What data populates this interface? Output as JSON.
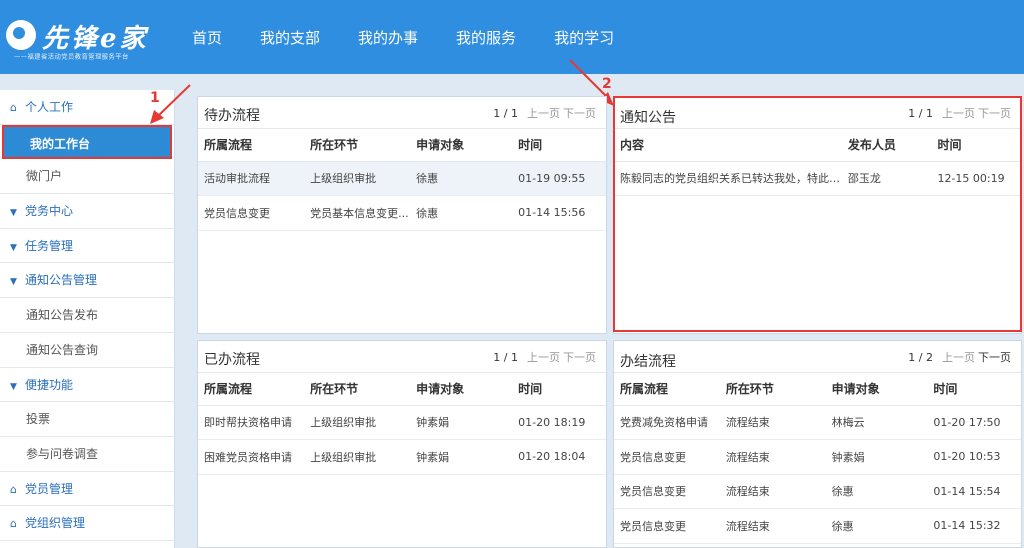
{
  "header": {
    "logo_title": "先锋e家",
    "logo_subtitle": "——福建省活动党员教育管理服务平台",
    "nav": [
      "首页",
      "我的支部",
      "我的办事",
      "我的服务",
      "我的学习"
    ]
  },
  "sidebar": {
    "items": [
      {
        "label": "个人工作",
        "type": "group",
        "icon": "home-icon"
      },
      {
        "label": "我的工作台",
        "type": "active"
      },
      {
        "label": "微门户",
        "type": "sub"
      },
      {
        "label": "党务中心",
        "type": "caret"
      },
      {
        "label": "任务管理",
        "type": "caret"
      },
      {
        "label": "通知公告管理",
        "type": "caret"
      },
      {
        "label": "通知公告发布",
        "type": "sub"
      },
      {
        "label": "通知公告查询",
        "type": "sub"
      },
      {
        "label": "便捷功能",
        "type": "caret"
      },
      {
        "label": "投票",
        "type": "sub"
      },
      {
        "label": "参与问卷调查",
        "type": "sub"
      },
      {
        "label": "党员管理",
        "type": "group",
        "icon": "home-icon"
      },
      {
        "label": "党组织管理",
        "type": "group",
        "icon": "home-icon"
      }
    ]
  },
  "annotations": {
    "one": "1",
    "two": "2"
  },
  "panels": {
    "pending": {
      "title": "待办流程",
      "pager": {
        "page": "1 / 1",
        "prev": "上一页",
        "next": "下一页"
      },
      "columns": [
        "所属流程",
        "所在环节",
        "申请对象",
        "时间"
      ],
      "rows": [
        [
          "活动审批流程",
          "上级组织审批",
          "徐惠",
          "01-19 09:55"
        ],
        [
          "党员信息变更",
          "党员基本信息变更...",
          "徐惠",
          "01-14 15:56"
        ]
      ]
    },
    "notice": {
      "title": "通知公告",
      "pager": {
        "page": "1 / 1",
        "prev": "上一页",
        "next": "下一页"
      },
      "columns": [
        "内容",
        "发布人员",
        "时间"
      ],
      "rows": [
        [
          "陈毅同志的党员组织关系已转达我处，特此回...",
          "邵玉龙",
          "12-15 00:19"
        ]
      ]
    },
    "done": {
      "title": "已办流程",
      "pager": {
        "page": "1 / 1",
        "prev": "上一页",
        "next": "下一页"
      },
      "columns": [
        "所属流程",
        "所在环节",
        "申请对象",
        "时间"
      ],
      "rows": [
        [
          "即时帮扶资格申请",
          "上级组织审批",
          "钟素娟",
          "01-20 18:19"
        ],
        [
          "困难党员资格申请",
          "上级组织审批",
          "钟素娟",
          "01-20 18:04"
        ]
      ]
    },
    "finished": {
      "title": "办结流程",
      "pager": {
        "page": "1 / 2",
        "prev": "上一页",
        "next": "下一页"
      },
      "columns": [
        "所属流程",
        "所在环节",
        "申请对象",
        "时间"
      ],
      "rows": [
        [
          "党费减免资格申请",
          "流程结束",
          "林梅云",
          "01-20 17:50"
        ],
        [
          "党员信息变更",
          "流程结束",
          "钟素娟",
          "01-20 10:53"
        ],
        [
          "党员信息变更",
          "流程结束",
          "徐惠",
          "01-14 15:54"
        ],
        [
          "党员信息变更",
          "流程结束",
          "徐惠",
          "01-14 15:32"
        ]
      ]
    }
  }
}
